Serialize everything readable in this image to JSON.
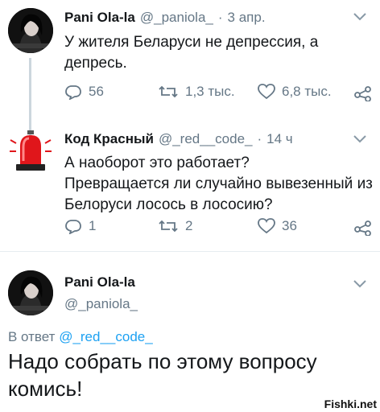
{
  "tweet1": {
    "name": "Pani Ola-la",
    "handle": "@_paniola_",
    "dot": "·",
    "date": "3 апр.",
    "text_line1": "У жителя Беларуси не депрессия, а",
    "text_line2": "депресь.",
    "replies": "56",
    "retweets": "1,3 тыс.",
    "likes": "6,8 тыс."
  },
  "tweet2": {
    "name": "Код Красный",
    "handle": "@_red__code_",
    "dot": "·",
    "date": "14 ч",
    "text_line1": "А наоборот это работает?",
    "text_line2": "Превращается ли случайно вывезенный из",
    "text_line3": "Белоруси лосось в лососию?",
    "replies": "1",
    "retweets": "2",
    "likes": "36"
  },
  "tweet3": {
    "name": "Pani Ola-la",
    "handle": "@_paniola_",
    "reply_prefix": "В ответ",
    "reply_handle": "@_red__code_",
    "text_line1": "Надо собрать по этому вопросу",
    "text_line2": "комись!"
  },
  "watermark": "Fishki.net",
  "colors": {
    "icon_gray": "#657786",
    "link_blue": "#1da1f2",
    "siren_red": "#e0161b"
  }
}
